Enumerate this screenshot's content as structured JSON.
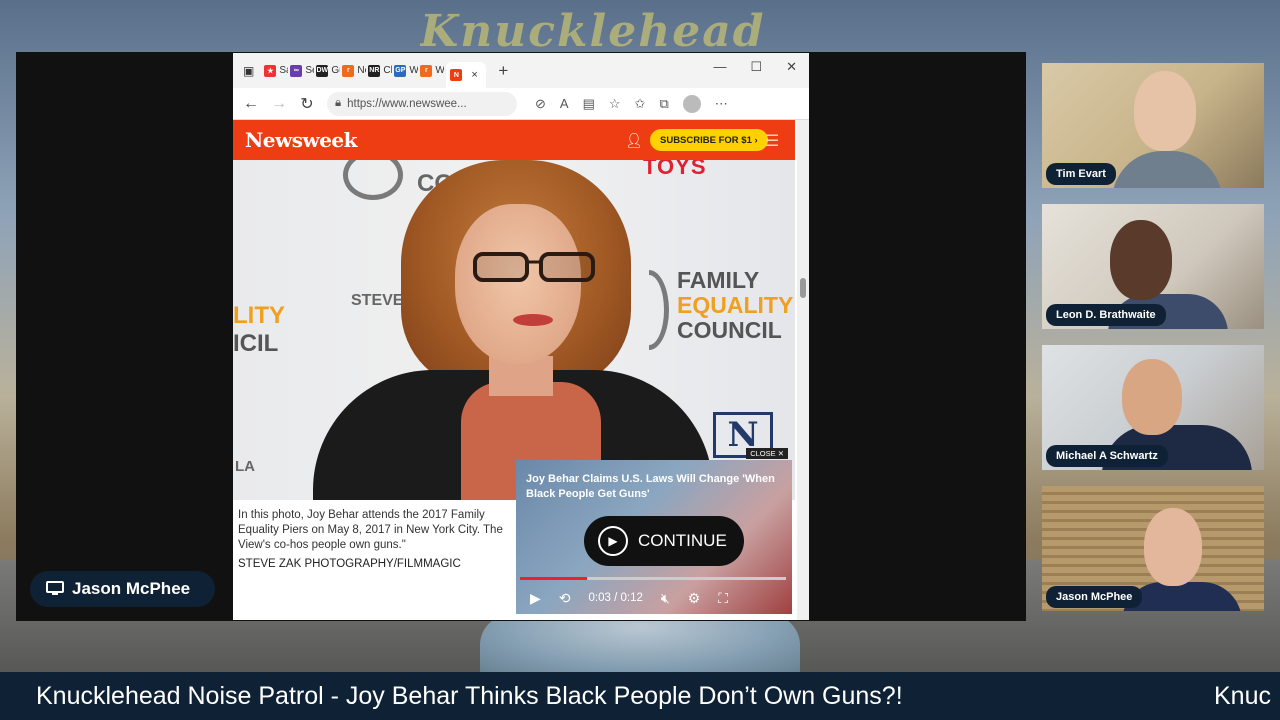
{
  "background": {
    "title_text": "Knucklehead",
    "accent": "#0f2235"
  },
  "presenter": {
    "name": "Jason McPhee",
    "icon": "monitor-icon"
  },
  "browser": {
    "tabs": [
      {
        "label": "Sa",
        "fav_color": "#e33",
        "fav_text": "★"
      },
      {
        "label": "Se",
        "fav_color": "#6a3ea8",
        "fav_text": "∞"
      },
      {
        "label": "Gu",
        "fav_color": "#222",
        "fav_text": "DW"
      },
      {
        "label": "Ne",
        "fav_color": "#ee6a20",
        "fav_text": "r"
      },
      {
        "label": "Ch",
        "fav_color": "#222",
        "fav_text": "NR"
      },
      {
        "label": "W",
        "fav_color": "#2a6bbf",
        "fav_text": "GP"
      },
      {
        "label": "Wi",
        "fav_color": "#ee6a20",
        "fav_text": "r"
      }
    ],
    "active_tab": {
      "fav_text": "N",
      "fav_color": "#ee3d13",
      "close": "×"
    },
    "new_tab": "+",
    "window_controls": [
      "—",
      "☐",
      "✕"
    ],
    "url": "https://www.newswee..."
  },
  "newsweek": {
    "logo": "Newsweek",
    "subscribe": "SUBSCRIBE FOR $1 ›",
    "backdrop": {
      "co": "CO",
      "fec_line1": "FAMILY",
      "fec_line2": "EQUALITY",
      "fec_line3": "COUNCIL",
      "ality_line1": "LITY",
      "ality_line2": "ICIL",
      "steve": "STEVEN",
      "la": "LA",
      "n_plate": "N",
      "toys": "TOYS"
    },
    "caption": "In this photo, Joy Behar attends the 2017 Family Equality Piers on May 8, 2017 in New York City. The View's co-hos people own guns.\"",
    "credit": "STEVE ZAK PHOTOGRAPHY/FILMMAGIC"
  },
  "video": {
    "close_label": "CLOSE ✕",
    "headline": "Joy Behar Claims U.S. Laws Will Change 'When Black People Get Guns'",
    "continue_label": "CONTINUE",
    "time": "0:03 / 0:12",
    "progress": 0.25
  },
  "participants": [
    {
      "name": "Tim Evart"
    },
    {
      "name": "Leon D. Brathwaite"
    },
    {
      "name": "Michael A Schwartz"
    },
    {
      "name": "Jason McPhee"
    }
  ],
  "ticker": {
    "text": "Knucklehead Noise Patrol - Joy Behar Thinks Black People Don’t Own Guns?!",
    "repeat_text": "Knuc"
  }
}
